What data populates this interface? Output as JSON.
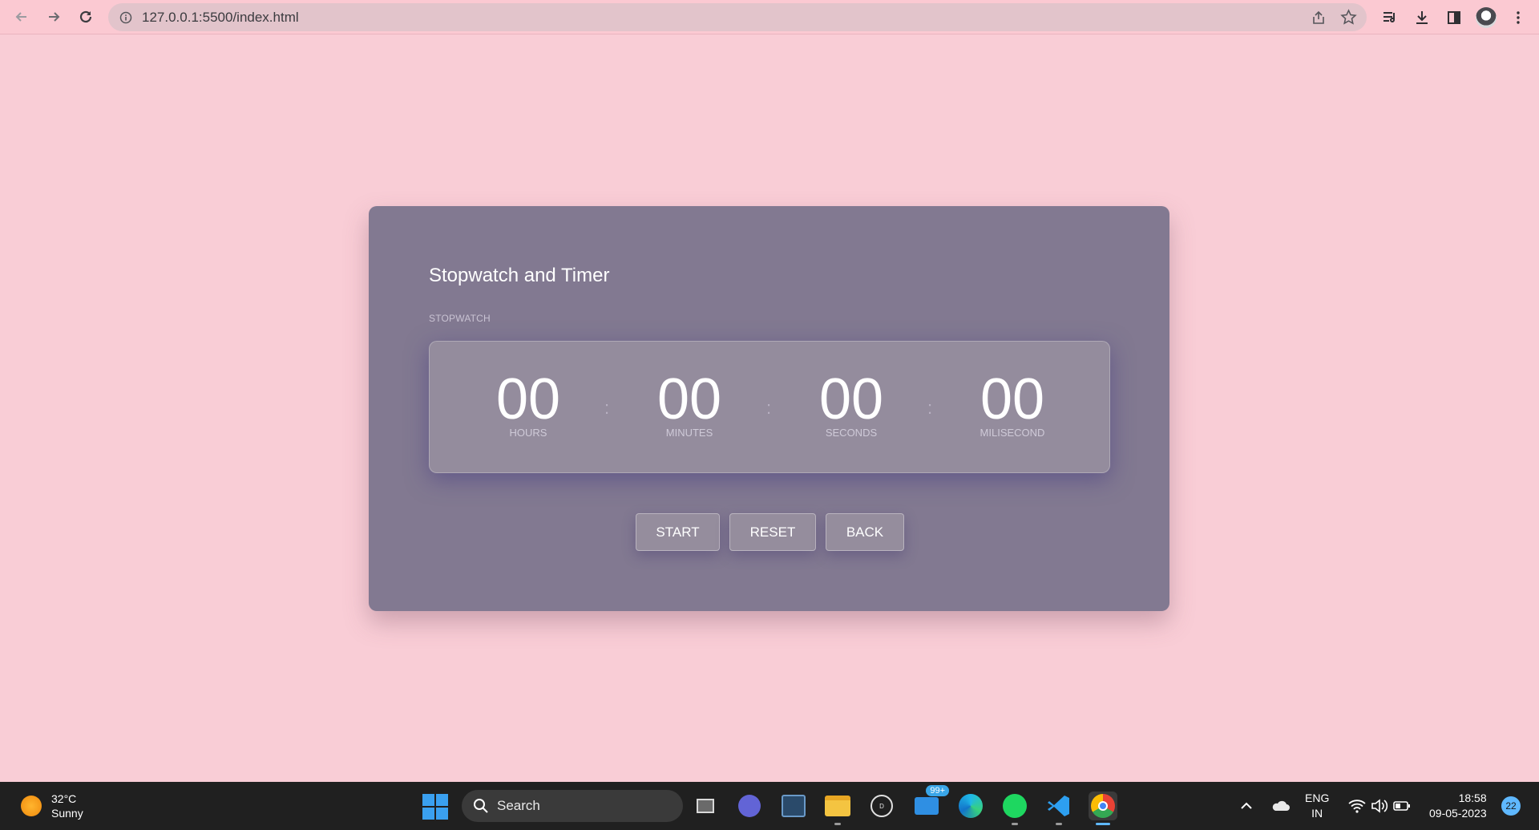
{
  "browser": {
    "url": "127.0.0.1:5500/index.html"
  },
  "app": {
    "title": "Stopwatch and Timer",
    "section_label": "STOPWATCH",
    "units": [
      {
        "value": "00",
        "label": "HOURS"
      },
      {
        "value": "00",
        "label": "MINUTES"
      },
      {
        "value": "00",
        "label": "SECONDS"
      },
      {
        "value": "00",
        "label": "MILISECOND"
      }
    ],
    "separator": ":",
    "buttons": {
      "start": "START",
      "reset": "RESET",
      "back": "BACK"
    }
  },
  "taskbar": {
    "weather": {
      "temp": "32°C",
      "condition": "Sunny"
    },
    "search_placeholder": "Search",
    "mail_badge": "99+",
    "language": {
      "line1": "ENG",
      "line2": "IN"
    },
    "clock": {
      "time": "18:58",
      "date": "09-05-2023"
    },
    "notification_count": "22"
  },
  "colors": {
    "page_background": "#f9cdd6",
    "card_background": "#7d768e",
    "display_background": "#948c9d",
    "taskbar": "#202020"
  },
  "icons": [
    "back-arrow-icon",
    "forward-arrow-icon",
    "reload-icon",
    "info-icon",
    "share-icon",
    "star-icon",
    "reading-list-icon",
    "download-icon",
    "side-panel-icon",
    "profile-avatar",
    "kebab-menu-icon",
    "sun-icon",
    "windows-start-icon",
    "search-icon",
    "task-view-icon",
    "teams-icon",
    "sql-icon",
    "file-explorer-icon",
    "dell-icon",
    "mail-icon",
    "edge-icon",
    "spotify-icon",
    "vscode-icon",
    "chrome-icon",
    "chevron-up-icon",
    "onedrive-icon",
    "wifi-icon",
    "volume-icon",
    "battery-icon"
  ]
}
